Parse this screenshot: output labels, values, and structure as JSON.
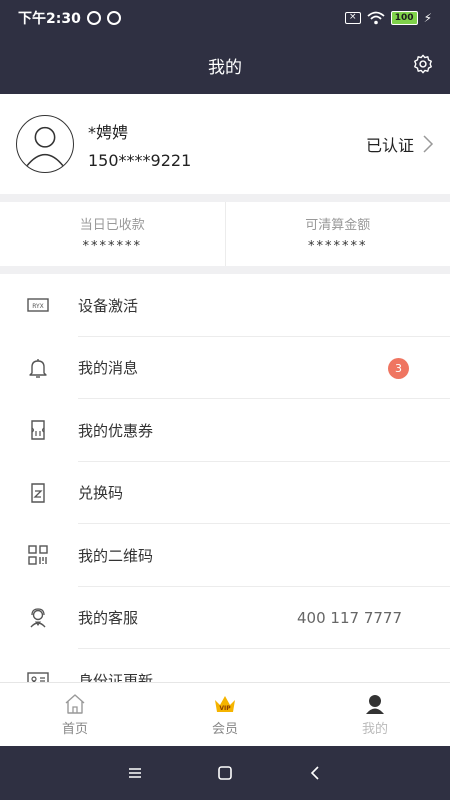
{
  "status_bar": {
    "time": "下午2:30",
    "battery": "100"
  },
  "header": {
    "title": "我的"
  },
  "profile": {
    "name": "*娉娉",
    "phone": "150****9221",
    "verified_label": "已认证"
  },
  "stats": [
    {
      "label": "当日已收款",
      "value": "*******"
    },
    {
      "label": "可清算金额",
      "value": "*******"
    }
  ],
  "menu": {
    "items": [
      {
        "label": "设备激活",
        "icon": "device-activation-icon"
      },
      {
        "label": "我的消息",
        "icon": "bell-icon",
        "badge": "3"
      },
      {
        "label": "我的优惠券",
        "icon": "coupon-icon"
      },
      {
        "label": "兑换码",
        "icon": "redeem-code-icon"
      },
      {
        "label": "我的二维码",
        "icon": "qr-code-icon"
      },
      {
        "label": "我的客服",
        "icon": "customer-service-icon",
        "value": "400 117 7777"
      },
      {
        "label": "身份证更新",
        "icon": "id-card-icon"
      }
    ]
  },
  "tabbar": {
    "tabs": [
      {
        "label": "首页",
        "icon": "home-icon"
      },
      {
        "label": "会员",
        "icon": "vip-crown-icon"
      },
      {
        "label": "我的",
        "icon": "profile-icon"
      }
    ],
    "active_index": 2
  },
  "colors": {
    "dark": "#2f3042",
    "badge": "#ef7561",
    "vip": "#f5b400"
  }
}
